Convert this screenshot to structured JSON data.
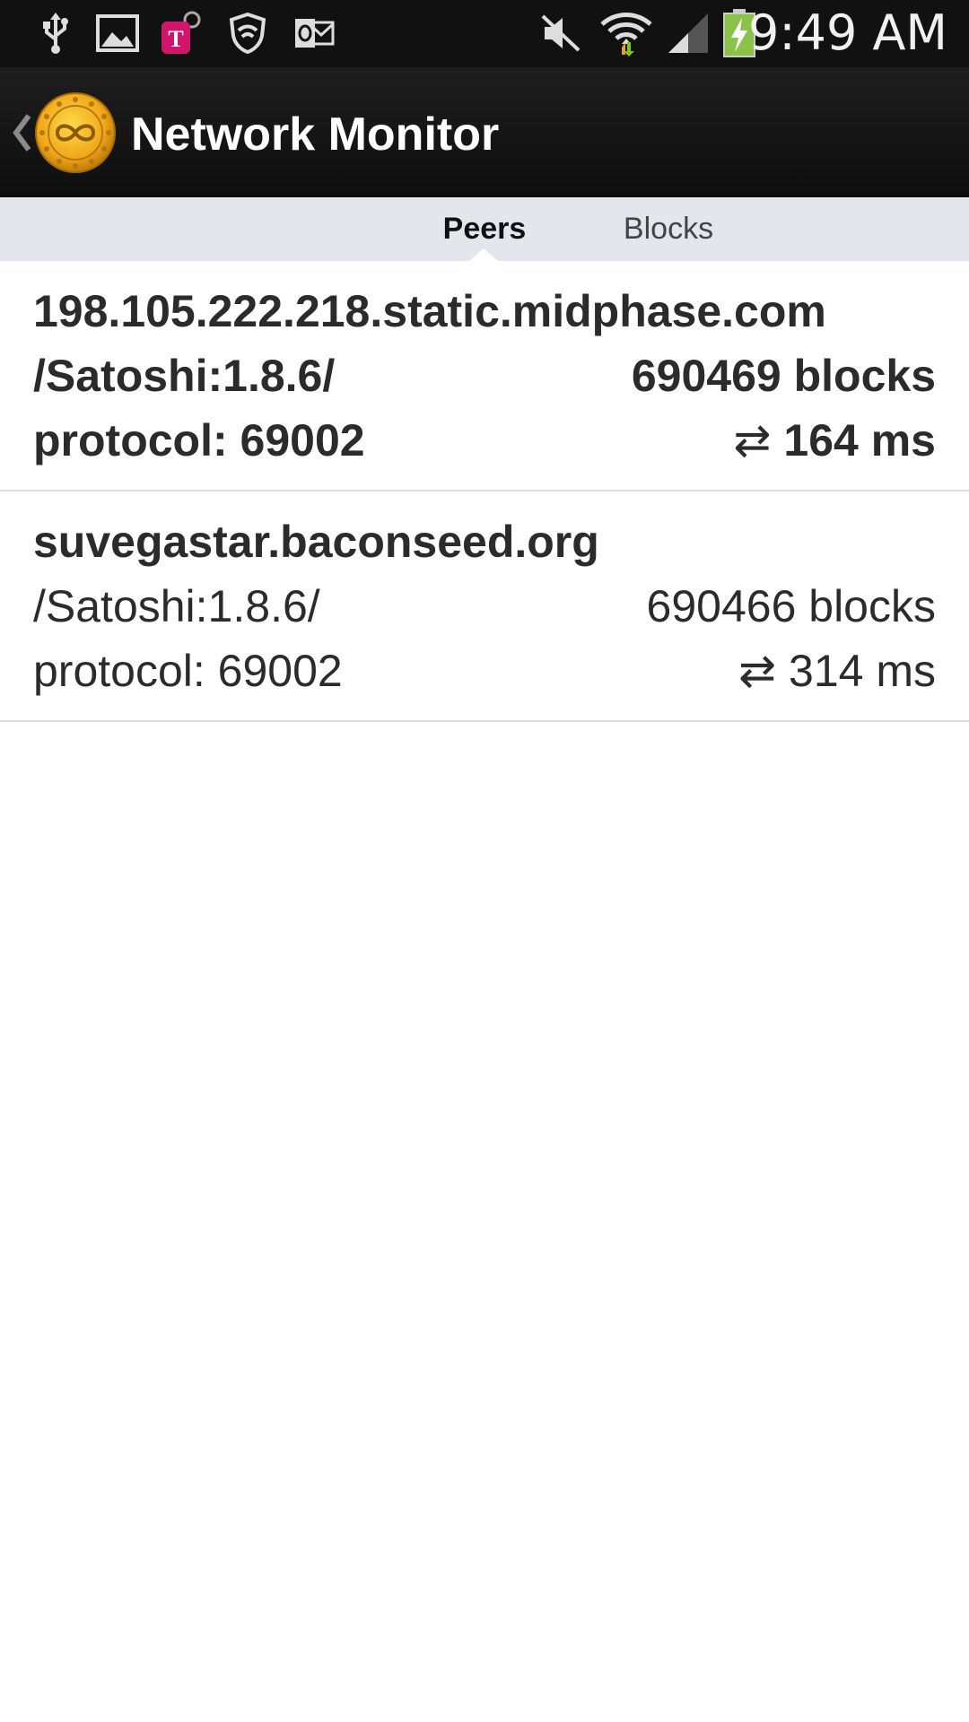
{
  "status_bar": {
    "time": "9:49 AM",
    "icons": [
      "usb-icon",
      "image-icon",
      "tmobile-tag-icon",
      "shield-icon",
      "outlook-icon",
      "mute-icon",
      "wifi-icon",
      "signal-icon",
      "battery-charging-icon"
    ]
  },
  "action_bar": {
    "title": "Network Monitor"
  },
  "tabs": [
    {
      "label": "Peers",
      "active": true
    },
    {
      "label": "Blocks",
      "active": false
    }
  ],
  "peers": [
    {
      "host": "198.105.222.218.static.midphase.com",
      "version": "/Satoshi:1.8.6/",
      "blocks": "690469 blocks",
      "protocol": "protocol: 69002",
      "ping_icon": "⇄",
      "ping": "164 ms"
    },
    {
      "host": "suvegastar.baconseed.org",
      "version": "/Satoshi:1.8.6/",
      "blocks": "690466 blocks",
      "protocol": "protocol: 69002",
      "ping_icon": "⇄",
      "ping": "314 ms"
    }
  ],
  "colors": {
    "status_bar_bg": "#111111",
    "action_bar_bg": "#151515",
    "tab_strip_bg": "#e4e6ee",
    "text": "#2b2b2b",
    "divider": "#dcdcdc"
  }
}
